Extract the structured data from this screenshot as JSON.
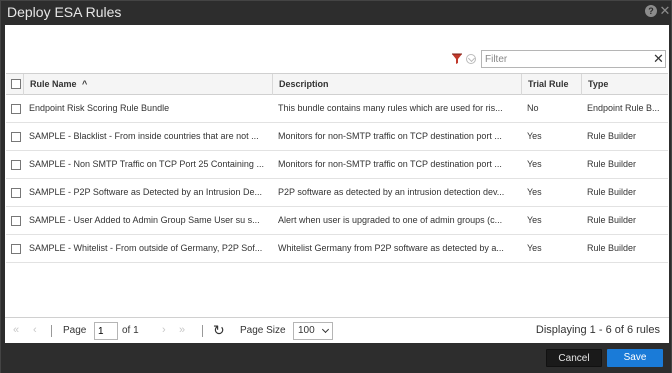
{
  "window": {
    "title": "Deploy ESA Rules"
  },
  "filter": {
    "placeholder": "Filter",
    "clear_glyph": "✕"
  },
  "table": {
    "columns": [
      "Rule Name",
      "Description",
      "Trial Rule",
      "Type"
    ],
    "sort_indicator": "^",
    "rows": [
      {
        "name": "Endpoint Risk Scoring Rule Bundle",
        "description": "This bundle contains many rules which are used for ris...",
        "trial": "No",
        "type": "Endpoint Rule B..."
      },
      {
        "name": "SAMPLE - Blacklist - From inside countries that are not ...",
        "description": "Monitors for non-SMTP traffic on TCP destination port ...",
        "trial": "Yes",
        "type": "Rule Builder"
      },
      {
        "name": "SAMPLE - Non SMTP Traffic on TCP Port 25 Containing ...",
        "description": "Monitors for non-SMTP traffic on TCP destination port ...",
        "trial": "Yes",
        "type": "Rule Builder"
      },
      {
        "name": "SAMPLE - P2P Software as Detected by an Intrusion De...",
        "description": "P2P software as detected by an intrusion detection dev...",
        "trial": "Yes",
        "type": "Rule Builder"
      },
      {
        "name": "SAMPLE - User Added to Admin Group Same User su s...",
        "description": "Alert when user is upgraded to one of admin groups (c...",
        "trial": "Yes",
        "type": "Rule Builder"
      },
      {
        "name": "SAMPLE - Whitelist - From outside of Germany, P2P Sof...",
        "description": "Whitelist Germany from P2P software as detected by a...",
        "trial": "Yes",
        "type": "Rule Builder"
      }
    ]
  },
  "pager": {
    "page_label": "Page",
    "page_value": "1",
    "of_label": "of 1",
    "page_size_label": "Page Size",
    "page_size_value": "100",
    "displaying": "Displaying 1 - 6 of 6 rules"
  },
  "buttons": {
    "cancel": "Cancel",
    "save": "Save"
  },
  "colors": {
    "accent": "#1a7bd8",
    "chrome": "#2d2d2d",
    "filter_icon": "#c0392b"
  },
  "icons": [
    "help-icon",
    "close-icon",
    "filter-funnel-icon",
    "chevron-down-icon",
    "clear-icon",
    "first-page-icon",
    "prev-page-icon",
    "next-page-icon",
    "last-page-icon",
    "refresh-icon",
    "sort-asc-icon"
  ]
}
